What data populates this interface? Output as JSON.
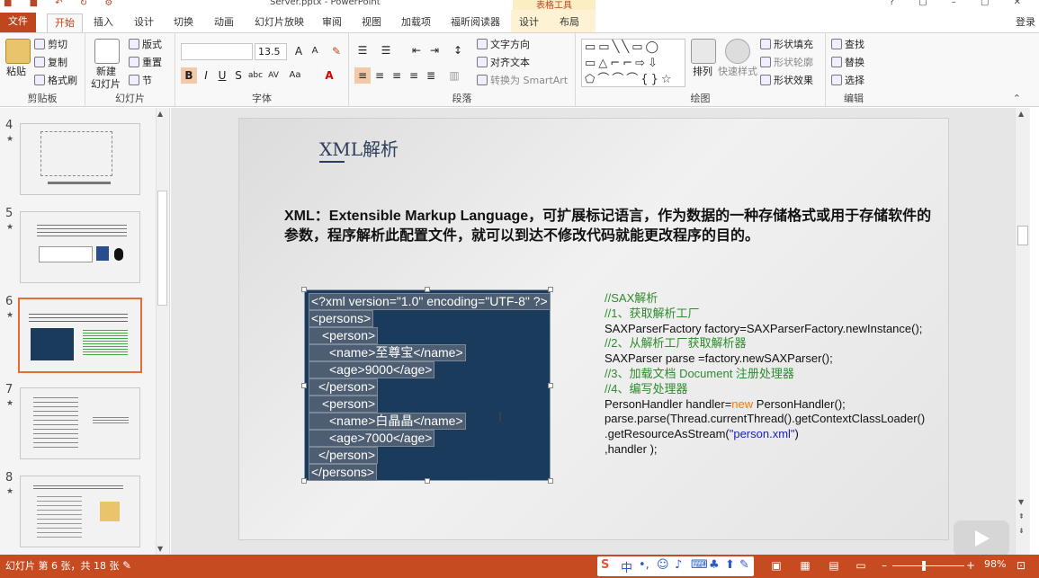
{
  "window": {
    "title": "Server.pptx - PowerPoint",
    "context_tab_group": "表格工具"
  },
  "tabs": [
    "文件",
    "开始",
    "插入",
    "设计",
    "切换",
    "动画",
    "幻灯片放映",
    "审阅",
    "视图",
    "加载项",
    "福昕阅读器",
    "设计",
    "布局"
  ],
  "login": "登录",
  "ribbon": {
    "clipboard": {
      "label": "剪贴板",
      "paste": "粘贴",
      "cut": "剪切",
      "copy": "复制",
      "format_painter": "格式刷"
    },
    "slides": {
      "label": "幻灯片",
      "new_slide": "新建",
      "new_slide2": "幻灯片",
      "layout": "版式",
      "reset": "重置",
      "section": "节"
    },
    "font": {
      "label": "字体",
      "font_name": "",
      "font_size": "13.5"
    },
    "paragraph": {
      "label": "段落",
      "text_direction": "文字方向",
      "align_text": "对齐文本",
      "smartart": "转换为 SmartArt"
    },
    "drawing": {
      "label": "绘图",
      "arrange": "排列",
      "quick_styles": "快速样式",
      "shape_fill": "形状填充",
      "shape_outline": "形状轮廓",
      "shape_effects": "形状效果"
    },
    "editing": {
      "label": "编辑",
      "find": "查找",
      "replace": "替换",
      "select": "选择"
    }
  },
  "thumbnails": [
    {
      "num": "4",
      "star": "★"
    },
    {
      "num": "5",
      "star": "★"
    },
    {
      "num": "6",
      "star": "★"
    },
    {
      "num": "7",
      "star": "★"
    },
    {
      "num": "8",
      "star": "★"
    }
  ],
  "slide": {
    "title": "XML解析",
    "intro": "XML：Extensible Markup Language，可扩展标记语言，作为数据的一种存储格式或用于存储软件的参数，程序解析此配置文件，就可以到达不修改代码就能更改程序的目的。",
    "xml_lines": [
      "<?xml version=\"1.0\" encoding=\"UTF-8\" ?>",
      "<persons>",
      "<person>",
      "<name>至尊宝</name>",
      "<age>9000</age>",
      "</person>",
      "<person>",
      "<name>白晶晶</name>",
      "<age>7000</age>",
      "</person>",
      "</persons>"
    ],
    "code": {
      "c1": "//SAX解析",
      "c2": "//1、获取解析工厂",
      "l3": "SAXParserFactory factory=SAXParserFactory.newInstance();",
      "c4": "//2、从解析工厂获取解析器",
      "l5": "SAXParser parse =factory.newSAXParser();",
      "c6": "//3、加载文档 Document 注册处理器",
      "c7": "//4、编写处理器",
      "l8a": "PersonHandler handler=",
      "l8k": "new",
      "l8b": " PersonHandler();",
      "l9": "parse.parse(Thread.currentThread().getContextClassLoader()",
      "l10a": ".getResourceAsStream(",
      "l10s": "\"person.xml\"",
      "l10b": ")",
      "l11": ",handler );"
    }
  },
  "status": {
    "slide_info": "幻灯片 第 6 张，共 18 张",
    "zoom": "98%",
    "ime_lang": "中"
  },
  "colors": {
    "accent": "#c64b20",
    "xml_bg": "#1b3b5c",
    "comment": "#2e8b2e",
    "keyword": "#ff7700",
    "string": "#1a22b6"
  }
}
